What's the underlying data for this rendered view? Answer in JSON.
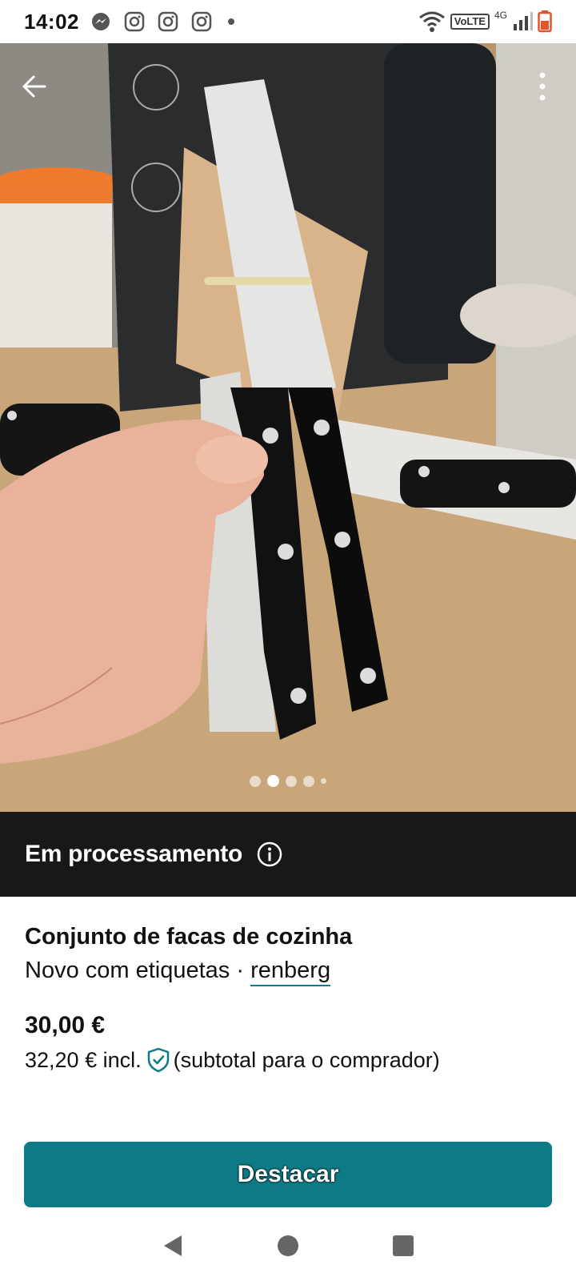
{
  "status_bar": {
    "time": "14:02",
    "icons": [
      "messenger-icon",
      "instagram-icon",
      "instagram-icon",
      "instagram-icon",
      "notification-dot-icon"
    ],
    "right_icons": [
      "wifi-icon",
      "volte-icon",
      "signal-icon",
      "battery-icon"
    ],
    "volte_label": "VoLTE",
    "network_label": "4G"
  },
  "gallery": {
    "photo_count": 5,
    "current_index": 2
  },
  "banner": {
    "text": "Em processamento"
  },
  "item": {
    "title": "Conjunto de facas de cozinha",
    "condition": "Novo com etiquetas",
    "separator": "·",
    "seller": "renberg",
    "price": "30,00 €",
    "price_incl": "32,20 €",
    "incl_label": "incl.",
    "subtotal_note": "(subtotal para o comprador)"
  },
  "cta": {
    "label": "Destacar"
  },
  "colors": {
    "accent": "#0d7a85",
    "banner_bg": "#171919"
  }
}
